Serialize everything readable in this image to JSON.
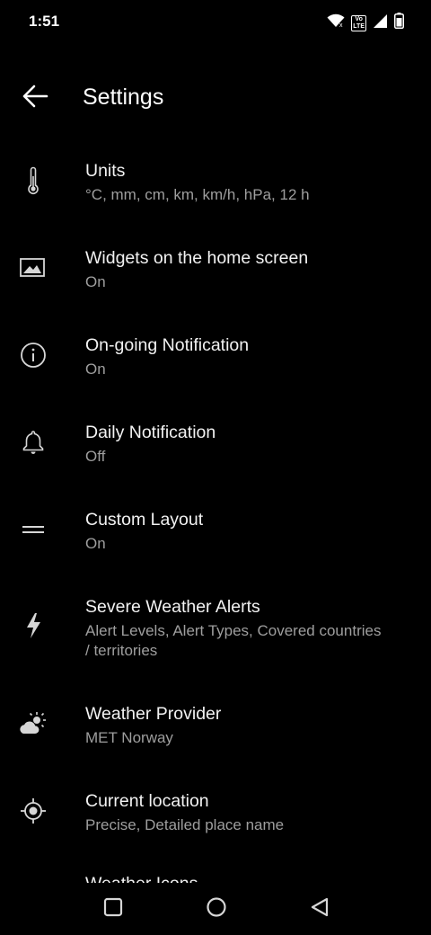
{
  "status_bar": {
    "time": "1:51",
    "volte_label": "Vo LTE",
    "icons": [
      "wifi-icon",
      "volte-icon",
      "signal-icon",
      "battery-icon"
    ]
  },
  "app_bar": {
    "title": "Settings",
    "back_icon": "arrow-back-icon"
  },
  "settings": [
    {
      "icon": "thermometer-icon",
      "title": "Units",
      "subtitle": "°C, mm, cm, km, km/h, hPa, 12 h"
    },
    {
      "icon": "image-icon",
      "title": "Widgets on the home screen",
      "subtitle": "On"
    },
    {
      "icon": "info-icon",
      "title": "On-going Notification",
      "subtitle": "On"
    },
    {
      "icon": "bell-icon",
      "title": "Daily Notification",
      "subtitle": "Off"
    },
    {
      "icon": "drag-handle-icon",
      "title": "Custom Layout",
      "subtitle": "On"
    },
    {
      "icon": "lightning-icon",
      "title": "Severe Weather Alerts",
      "subtitle": "Alert Levels, Alert Types, Covered countries / territories"
    },
    {
      "icon": "sun-cloud-icon",
      "title": "Weather Provider",
      "subtitle": "MET Norway"
    },
    {
      "icon": "location-target-icon",
      "title": "Current location",
      "subtitle": "Precise, Detailed place name"
    },
    {
      "icon": "",
      "title": "Weather Icons",
      "subtitle": ""
    }
  ],
  "nav_bar": {
    "buttons": [
      "recents-square-icon",
      "home-circle-icon",
      "back-triangle-icon"
    ]
  },
  "colors": {
    "background": "#000000",
    "title_text": "#f2f2f2",
    "subtitle_text": "#9e9e9e",
    "icon": "#d6d6d6"
  }
}
